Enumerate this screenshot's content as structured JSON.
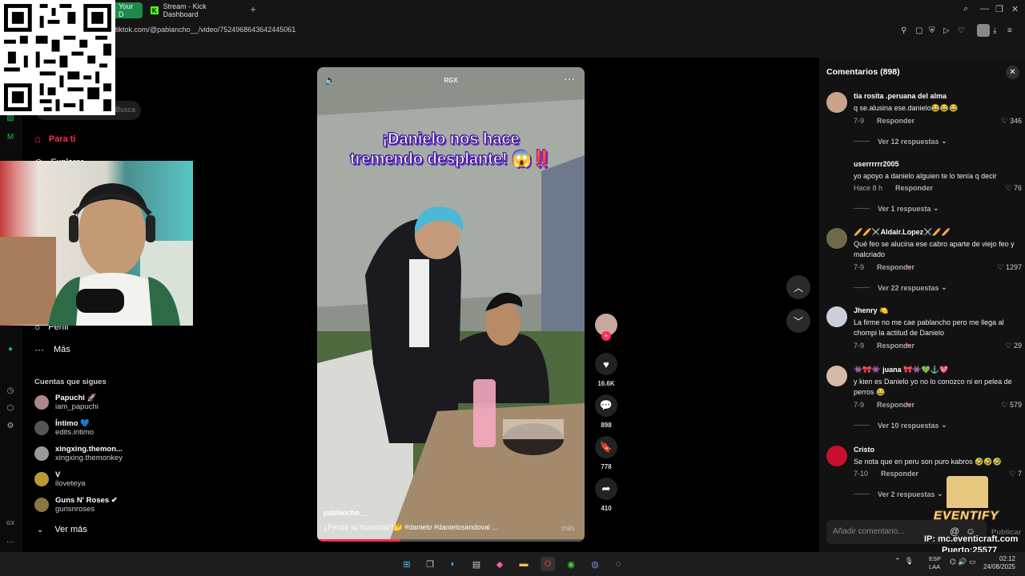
{
  "browser": {
    "tab1_label": "Your D",
    "tab2_label": "Stream - Kick Dashboard",
    "url": "tiktok.com/@pablancho__/video/7524968643642445061"
  },
  "sidebar": {
    "search_placeholder": "Busca",
    "nav": [
      {
        "label": "Para ti",
        "icon": "home-icon"
      },
      {
        "label": "Explorar",
        "icon": "compass-icon"
      },
      {
        "label": "Perfil",
        "icon": "profile-icon"
      },
      {
        "label": "Más",
        "icon": "more-icon"
      }
    ],
    "following_title": "Cuentas que sigues",
    "following": [
      {
        "name": "Papuchi 🚀",
        "handle": "iam_papuchi"
      },
      {
        "name": "Íntimo 💙",
        "handle": "edits.intimo"
      },
      {
        "name": "xingxing.themon...",
        "handle": "xingxing.themonkey"
      },
      {
        "name": "V",
        "handle": "iloveteya"
      },
      {
        "name": "Guns N' Roses ✔",
        "handle": "gunsnroses"
      }
    ],
    "see_more": "Ver más"
  },
  "video": {
    "watermark": "RGX",
    "title_line1": "¡Danielo nos hace",
    "title_line2": "tremendo desplante! 😱‼️",
    "author": "pablancho__",
    "caption": "¿Perdió su humildad?🤔 #danielo #danielosandoval ...",
    "more_label": "más",
    "progress": 0.31
  },
  "actions": {
    "likes": "16.6K",
    "comments": "898",
    "saves": "778",
    "shares": "410"
  },
  "comments_panel": {
    "title": "Comentarios (898)",
    "reply_label": "Responder",
    "add_placeholder": "Añadir comentario...",
    "publish_label": "Publicar",
    "items": [
      {
        "user": "tia rosita .peruana del alma",
        "text": "q se.alusina ese.danielo😂😂😂",
        "date": "7-9",
        "likes": "346",
        "replies": "Ver 12 respuestas"
      },
      {
        "user": "userrrrrr2005",
        "text": "yo apoyo a danielo alguien te lo tenía q decir",
        "date": "Hace 8 h",
        "likes": "76",
        "replies": "Ver 1 respuesta"
      },
      {
        "user": "🥖🥖⚔️Aldair.Lopez⚔️🥖🥖",
        "text": "Qué feo se alucina ese cabro aparte de viejo feo y malcriado",
        "date": "7-9",
        "likes": "1297",
        "replies": "Ver 22 respuestas"
      },
      {
        "user": "Jhenry 🍋",
        "text": "La firme no me cae pablancho pero me llega al chompi la actitud de Danielo",
        "date": "7-9",
        "likes": "29",
        "replies": ""
      },
      {
        "user": "👾🎀👾 juana 🎀👾💚⚓💖",
        "text": "y kien es Danielo yo no lo conozco ni en pelea de perros 😂",
        "date": "7-9",
        "likes": "579",
        "replies": "Ver 10 respuestas"
      },
      {
        "user": "Cristo",
        "text": "Se nota que en peru son puro kabros 🤣🤣🤣",
        "date": "7-10",
        "likes": "7",
        "replies": "Ver 2 respuestas"
      }
    ]
  },
  "overlay": {
    "brand": "EVENTIFY",
    "ip": "IP: mc.eventicraft.com",
    "port": "Puerto:25577"
  },
  "taskbar": {
    "lang_line1": "ESP",
    "lang_line2": "LAA",
    "time": "02:12",
    "date": "24/08/2025"
  },
  "colors": {
    "accent": "#fe2c55",
    "kick_green": "#53fc18",
    "panel_bg": "#121212"
  }
}
